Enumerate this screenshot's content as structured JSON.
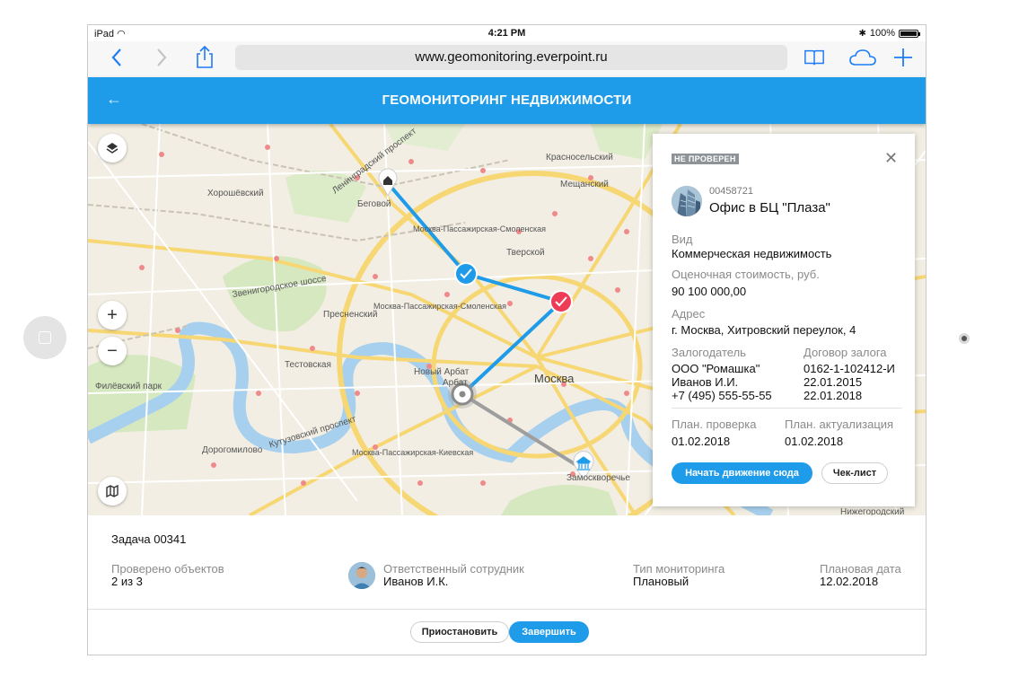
{
  "status_bar": {
    "device": "iPad",
    "time": "4:21 PM",
    "battery": "100%"
  },
  "browser": {
    "url": "www.geomonitoring.everpoint.ru",
    "icons": [
      "chevron-left-icon",
      "chevron-right-icon",
      "share-icon",
      "book-icon",
      "cloud-icon",
      "plus-icon"
    ]
  },
  "header": {
    "title": "ГЕОМОНИТОРИНГ НЕДВИЖИМОСТИ",
    "back_icon": "arrow-left-icon",
    "accent": "#1e9be9"
  },
  "map": {
    "labels": {
      "khoroshevsky": "Хорошёвский",
      "begovoy": "Беговой",
      "tverskoy": "Тверской",
      "meshchansky": "Мещанский",
      "krasnoselsky": "Красносельский",
      "presnensky": "Пресненский",
      "filevsky_park": "Филёвский парк",
      "arbat": "Арбат",
      "moskva": "Москва",
      "dorogomilovo": "Дорогомилово",
      "zamoskvorechye": "Замоскворечье",
      "nizhegorodsky": "Нижегородский",
      "novy_arbat": "Новый Арбат",
      "testovskaya": "Тестовская",
      "kutuzovsky": "Кутузовский проспект",
      "leningradsky": "Ленинградский проспект",
      "zvenigorodskoe": "Звенигородское шоссе",
      "mpsr_1": "Москва-Пассажирская-Смоленская",
      "mpsr_2": "Москва-Пассажирская-Смоленская",
      "mpk": "Москва-Пассажирская-Киевская"
    },
    "route_colors": {
      "done": "#1e9be9",
      "pending": "#9e9e9e"
    }
  },
  "card": {
    "status_badge": "НЕ ПРОВЕРЕН",
    "object_id": "00458721",
    "object_name": "Офис в БЦ \"Плаза\"",
    "type_label": "Вид",
    "type_value": "Коммерческая недвижимость",
    "cost_label": "Оценочная стоимость, руб.",
    "cost_value": "90 100 000,00",
    "address_label": "Адрес",
    "address_value": "г. Москва, Хитровский переулок, 4",
    "pledger_label": "Залогодатель",
    "pledger_company": "ООО \"Ромашка\"",
    "pledger_person": "Иванов И.И.",
    "pledger_phone": "+7 (495) 555-55-55",
    "contract_label": "Договор залога",
    "contract_number": "0162-1-102412-И",
    "contract_date_1": "22.01.2015",
    "contract_date_2": "22.01.2018",
    "plan_check_label": "План. проверка",
    "plan_check_value": "01.02.2018",
    "plan_update_label": "План. актуализация",
    "plan_update_value": "01.02.2018",
    "start_button": "Начать движение сюда",
    "checklist_button": "Чек-лист"
  },
  "task": {
    "title": "Задача 00341",
    "checked_label": "Проверено объектов",
    "checked_value": "2 из 3",
    "employee_label": "Ответственный сотрудник",
    "employee_value": "Иванов И.К.",
    "monitoring_label": "Тип мониторинга",
    "monitoring_value": "Плановый",
    "date_label": "Плановая дата",
    "date_value": "12.02.2018",
    "pause_button": "Приостановить",
    "finish_button": "Завершить"
  }
}
